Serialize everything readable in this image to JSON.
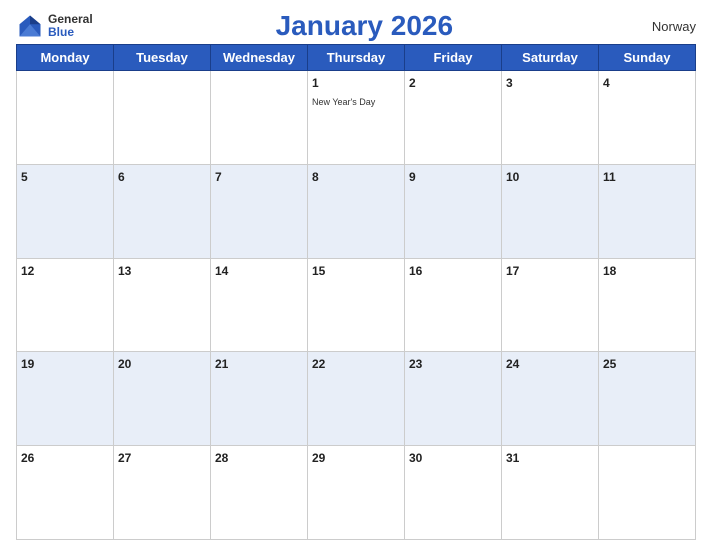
{
  "header": {
    "logo_general": "General",
    "logo_blue": "Blue",
    "title": "January 2026",
    "country": "Norway"
  },
  "calendar": {
    "weekdays": [
      "Monday",
      "Tuesday",
      "Wednesday",
      "Thursday",
      "Friday",
      "Saturday",
      "Sunday"
    ],
    "weeks": [
      [
        {
          "day": "",
          "holiday": ""
        },
        {
          "day": "",
          "holiday": ""
        },
        {
          "day": "",
          "holiday": ""
        },
        {
          "day": "1",
          "holiday": "New Year's Day"
        },
        {
          "day": "2",
          "holiday": ""
        },
        {
          "day": "3",
          "holiday": ""
        },
        {
          "day": "4",
          "holiday": ""
        }
      ],
      [
        {
          "day": "5",
          "holiday": ""
        },
        {
          "day": "6",
          "holiday": ""
        },
        {
          "day": "7",
          "holiday": ""
        },
        {
          "day": "8",
          "holiday": ""
        },
        {
          "day": "9",
          "holiday": ""
        },
        {
          "day": "10",
          "holiday": ""
        },
        {
          "day": "11",
          "holiday": ""
        }
      ],
      [
        {
          "day": "12",
          "holiday": ""
        },
        {
          "day": "13",
          "holiday": ""
        },
        {
          "day": "14",
          "holiday": ""
        },
        {
          "day": "15",
          "holiday": ""
        },
        {
          "day": "16",
          "holiday": ""
        },
        {
          "day": "17",
          "holiday": ""
        },
        {
          "day": "18",
          "holiday": ""
        }
      ],
      [
        {
          "day": "19",
          "holiday": ""
        },
        {
          "day": "20",
          "holiday": ""
        },
        {
          "day": "21",
          "holiday": ""
        },
        {
          "day": "22",
          "holiday": ""
        },
        {
          "day": "23",
          "holiday": ""
        },
        {
          "day": "24",
          "holiday": ""
        },
        {
          "day": "25",
          "holiday": ""
        }
      ],
      [
        {
          "day": "26",
          "holiday": ""
        },
        {
          "day": "27",
          "holiday": ""
        },
        {
          "day": "28",
          "holiday": ""
        },
        {
          "day": "29",
          "holiday": ""
        },
        {
          "day": "30",
          "holiday": ""
        },
        {
          "day": "31",
          "holiday": ""
        },
        {
          "day": "",
          "holiday": ""
        }
      ]
    ],
    "accent_color": "#2a5bbd"
  }
}
